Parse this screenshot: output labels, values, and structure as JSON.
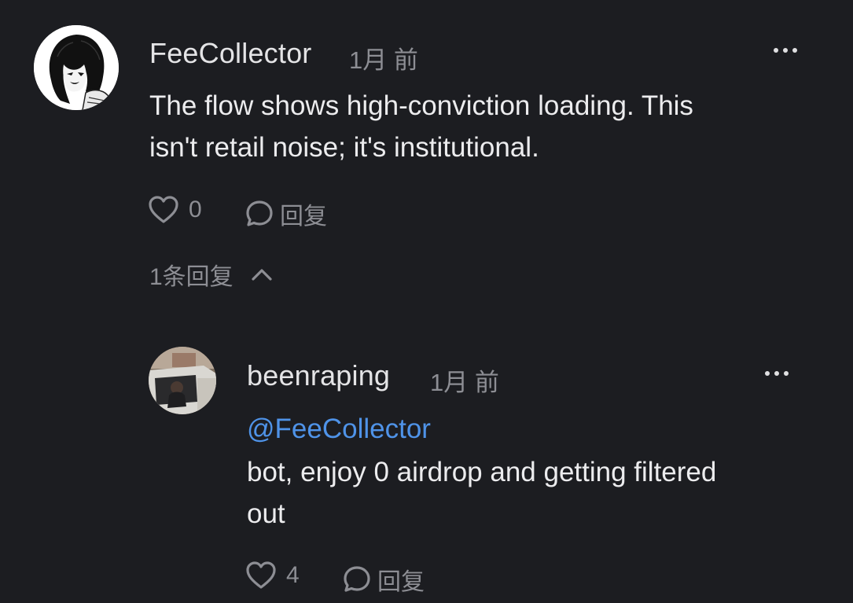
{
  "comment": {
    "username": "FeeCollector",
    "timestamp": "1月 前",
    "text_line1": "The flow shows high-conviction loading. This",
    "text_line2": "isn't retail noise; it's institutional.",
    "like_count": "0",
    "reply_label": "回复",
    "avatar_icon": "anime-character-avatar"
  },
  "replies_toggle": {
    "label": "1条回复",
    "icon": "chevron-up-icon"
  },
  "reply": {
    "username": "beenraping",
    "timestamp": "1月 前",
    "mention": "@FeeCollector",
    "text_line1": "bot, enjoy 0 airdrop and getting filtered",
    "text_line2": "out",
    "like_count": "4",
    "reply_label": "回复",
    "avatar_icon": "photo-avatar"
  },
  "colors": {
    "background": "#1c1d21",
    "mention": "#4f93e8",
    "muted": "#8d8e94"
  }
}
